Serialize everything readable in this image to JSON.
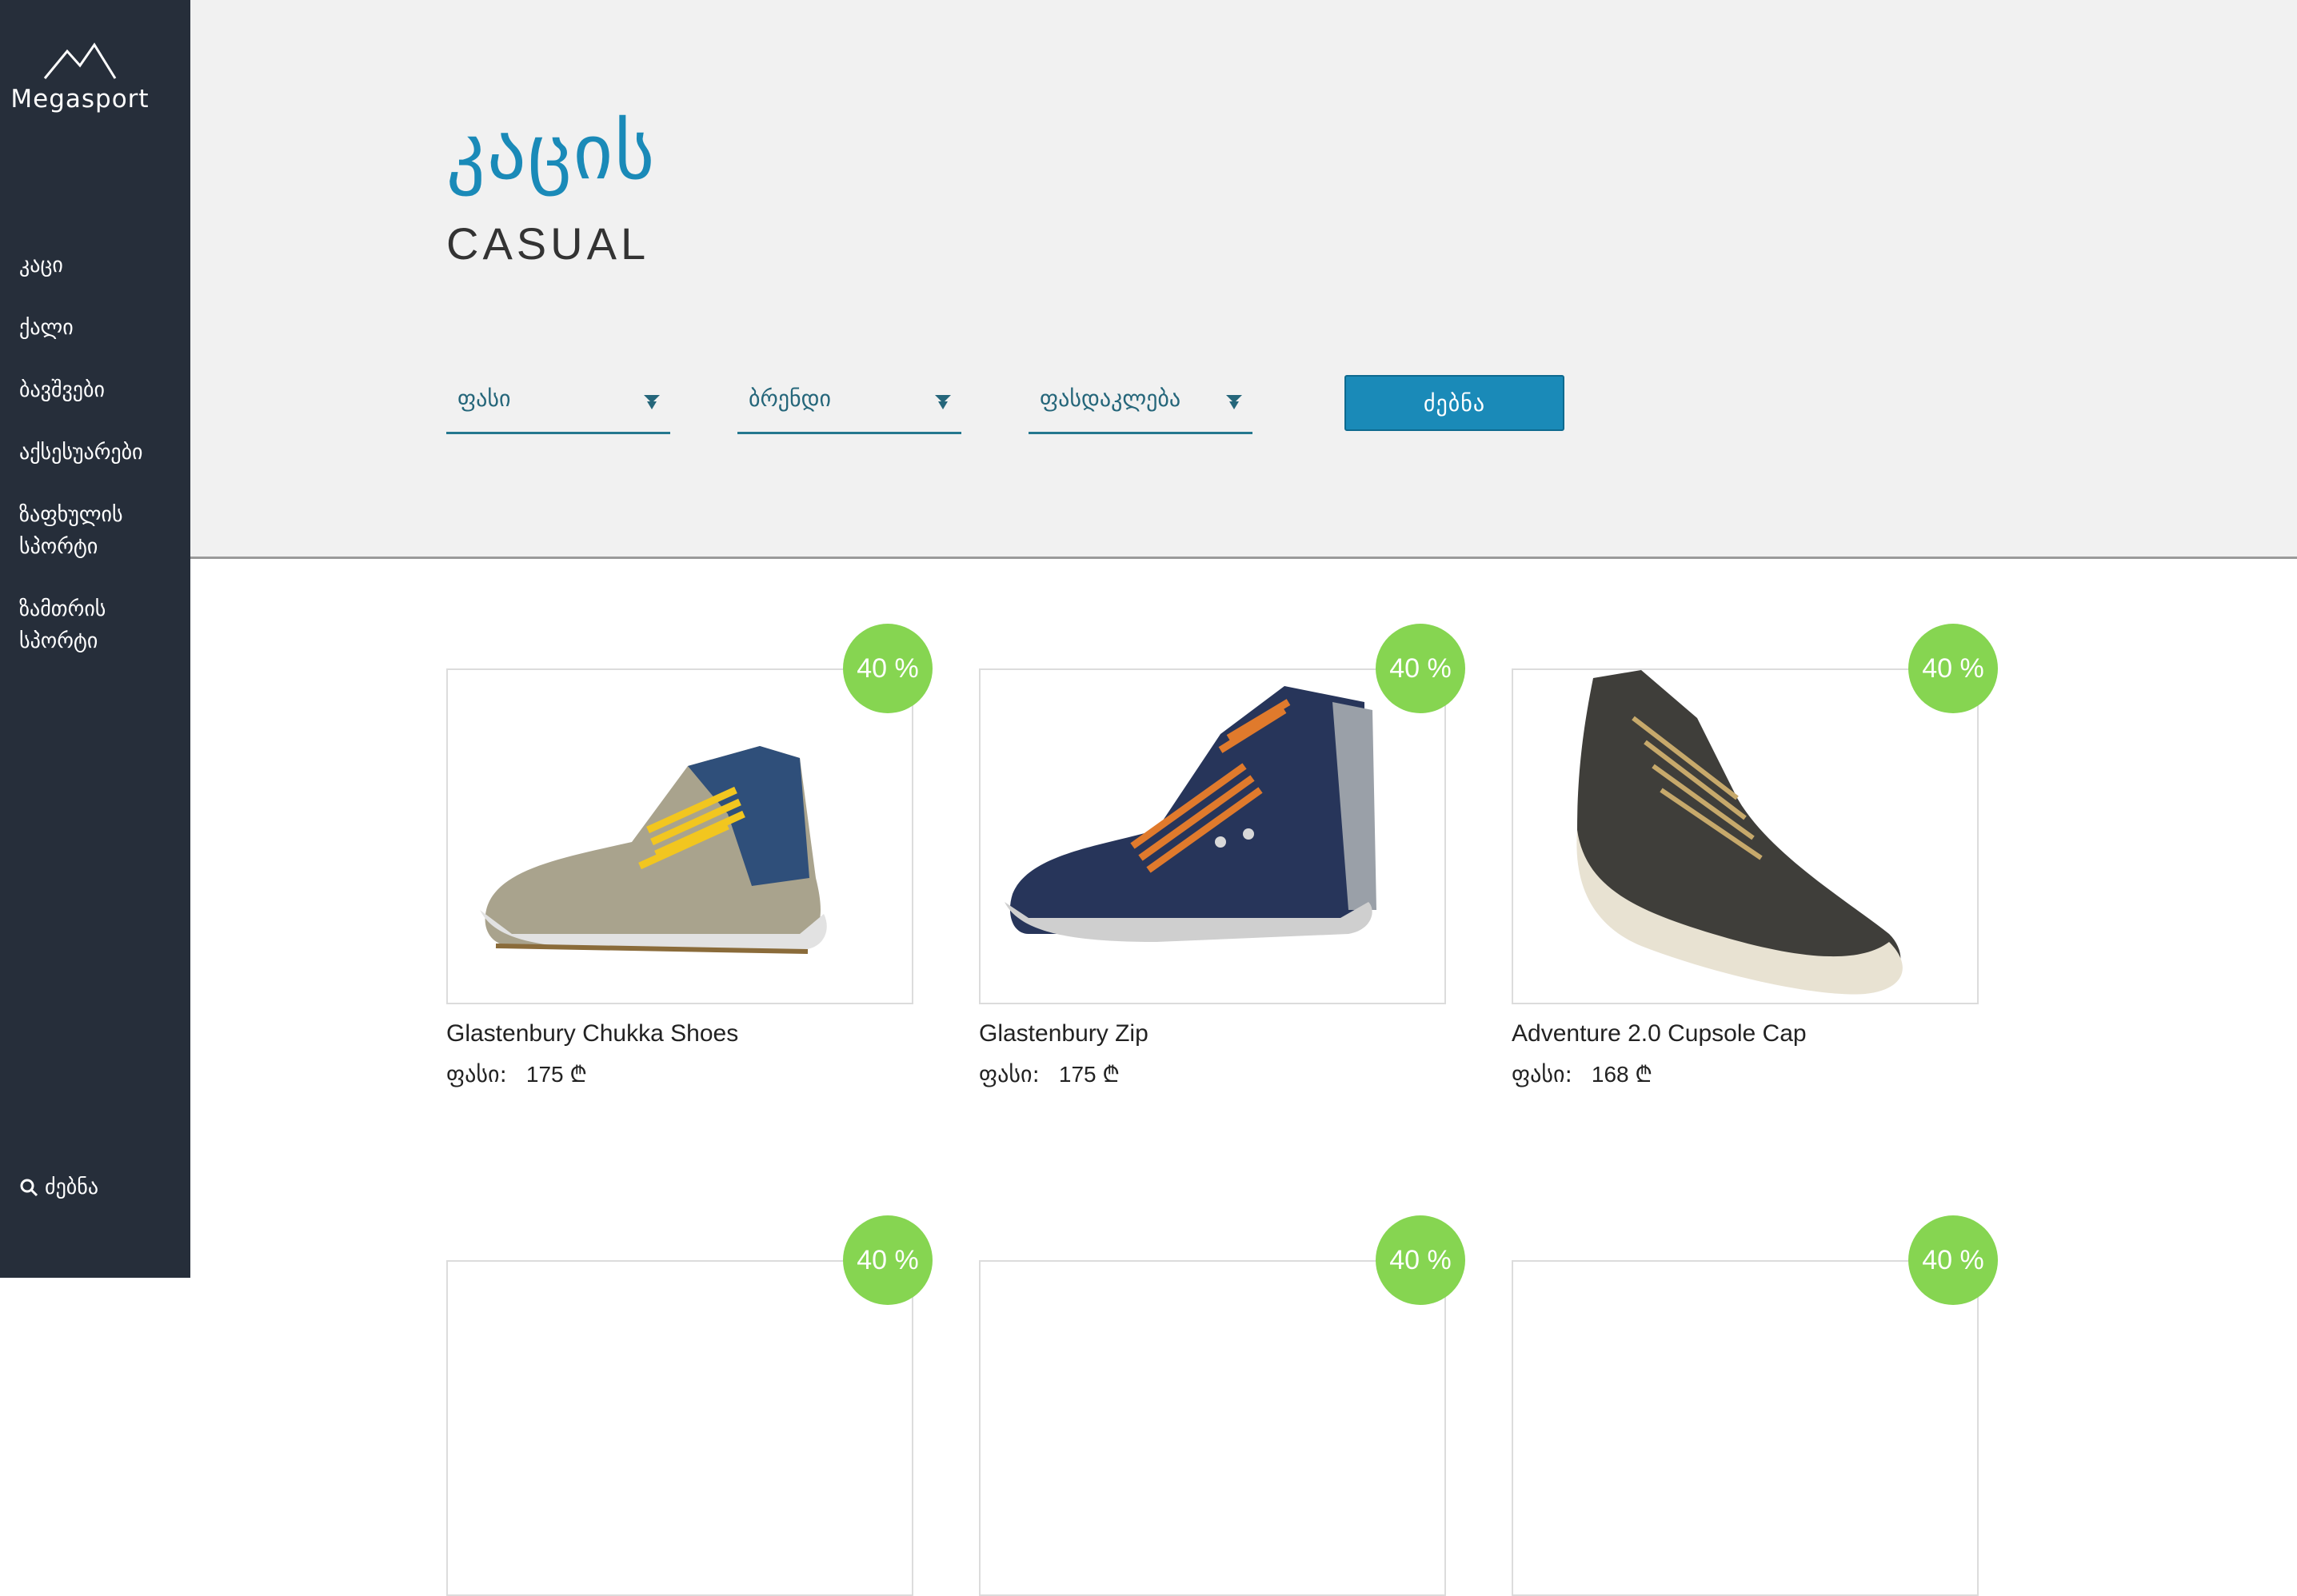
{
  "brand": {
    "name": "Megasport"
  },
  "nav": {
    "items": [
      {
        "label": "კაცი"
      },
      {
        "label": "ქალი"
      },
      {
        "label": "ბავშვები"
      },
      {
        "label": "აქსესუარები"
      },
      {
        "label": "ზაფხულის სპორტი"
      },
      {
        "label": "ზამთრის სპორტი"
      }
    ],
    "search_label": "ძებნა"
  },
  "header": {
    "title": "კაცის",
    "subtitle": "CASUAL"
  },
  "filters": {
    "price": "ფასი",
    "brand": "ბრენდი",
    "discount": "ფასდაკლება",
    "search_button": "ძებნა"
  },
  "products": [
    {
      "name": "Glastenbury Chukka Shoes",
      "price_label": "ფასი:",
      "price": "175 ₾",
      "discount": "40 %"
    },
    {
      "name": "Glastenbury Zip",
      "price_label": "ფასი:",
      "price": "175 ₾",
      "discount": "40 %"
    },
    {
      "name": "Adventure 2.0 Cupsole Cap",
      "price_label": "ფასი:",
      "price": "168 ₾",
      "discount": "40 %"
    },
    {
      "discount": "40 %"
    },
    {
      "discount": "40 %"
    },
    {
      "discount": "40 %"
    }
  ],
  "colors": {
    "sidebar": "#262e3a",
    "accent": "#1a8ab8",
    "badge": "#86d551",
    "header_bg": "#f1f1f1"
  }
}
